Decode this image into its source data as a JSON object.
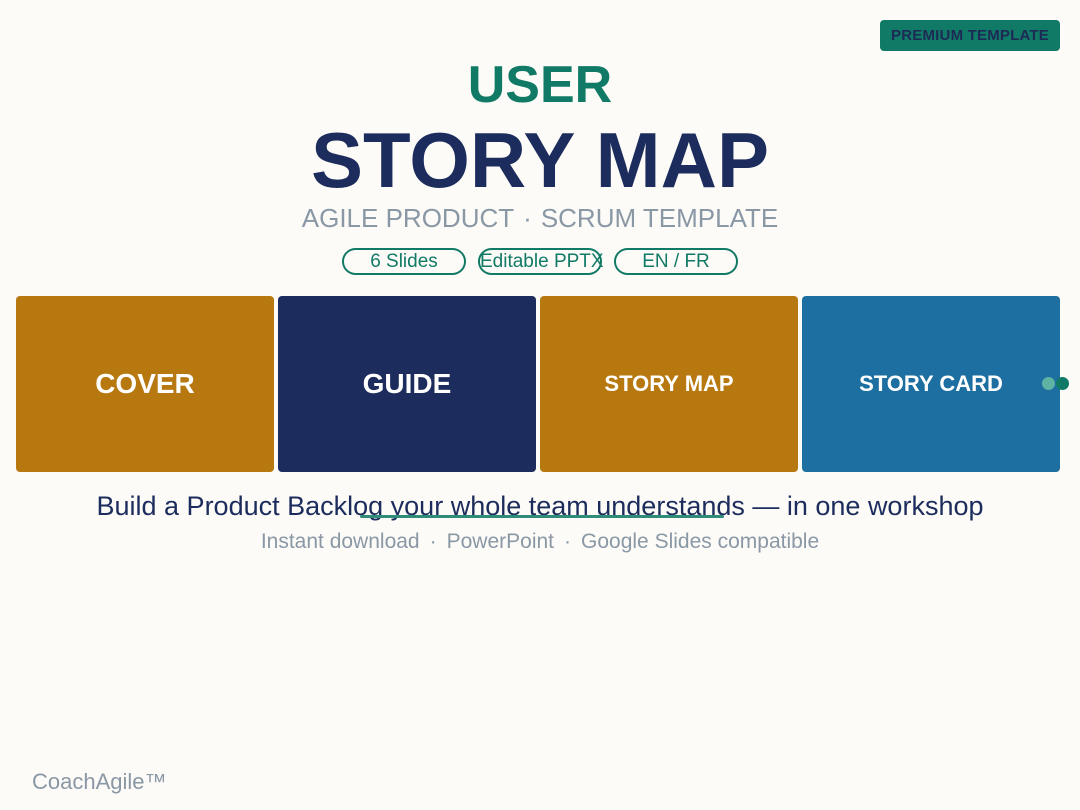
{
  "badge": {
    "label": "PREMIUM TEMPLATE"
  },
  "title": {
    "line1": "USER",
    "line2": "STORY MAP"
  },
  "subtitle": {
    "part1": "AGILE PRODUCT",
    "separator": "·",
    "part2": "SCRUM TEMPLATE"
  },
  "pills": [
    {
      "label": "6 Slides"
    },
    {
      "label": "Editable PPTX"
    },
    {
      "label": "EN / FR"
    }
  ],
  "cards": [
    {
      "label": "COVER",
      "color": "#b7780f"
    },
    {
      "label": "GUIDE",
      "color": "#1c2c5c"
    },
    {
      "label": "STORY MAP",
      "color": "#b7780f"
    },
    {
      "label": "STORY CARD",
      "color": "#1c6fa0"
    }
  ],
  "carousel_dots": [
    {
      "color": "#5fb3a2"
    },
    {
      "color": "#117a66"
    }
  ],
  "tagline": "Build a Product Backlog your whole team understands — in one workshop",
  "sub_tagline": {
    "item1": "Instant download",
    "item2": "PowerPoint",
    "item3": "Google Slides compatible",
    "separator": "·"
  },
  "brand": "CoachAgile™",
  "colors": {
    "accent_green": "#117a66",
    "navy": "#1c2c5c",
    "gold": "#b7780f",
    "blue": "#1c6fa0",
    "muted_gray": "#8a98a6",
    "background": "#fcfbf7"
  }
}
